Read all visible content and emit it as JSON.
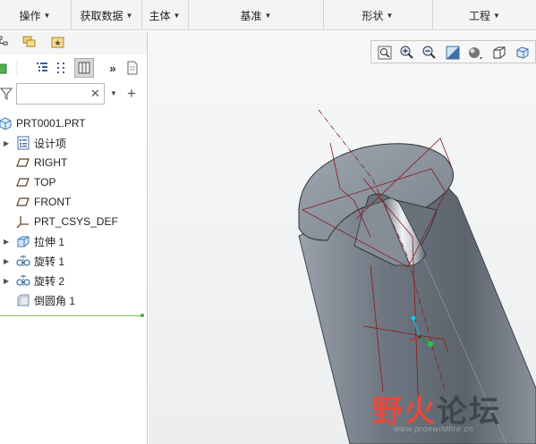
{
  "ribbon": {
    "groups": [
      "操作",
      "获取数据",
      "主体",
      "基准",
      "形状",
      "工程"
    ]
  },
  "model_tree": {
    "search_placeholder": "",
    "root": "PRT0001.PRT",
    "items": [
      {
        "label": "设计项",
        "expandable": true,
        "icon": "design-items-icon"
      },
      {
        "label": "RIGHT",
        "expandable": false,
        "icon": "datum-plane-icon"
      },
      {
        "label": "TOP",
        "expandable": false,
        "icon": "datum-plane-icon"
      },
      {
        "label": "FRONT",
        "expandable": false,
        "icon": "datum-plane-icon"
      },
      {
        "label": "PRT_CSYS_DEF",
        "expandable": false,
        "icon": "csys-icon"
      },
      {
        "label": "拉伸 1",
        "expandable": true,
        "icon": "extrude-icon"
      },
      {
        "label": "旋转 1",
        "expandable": true,
        "icon": "revolve-icon"
      },
      {
        "label": "旋转 2",
        "expandable": true,
        "icon": "revolve-icon"
      },
      {
        "label": "倒圆角 1",
        "expandable": false,
        "icon": "round-icon"
      }
    ]
  },
  "graphics_toolbar": {
    "buttons": [
      "refit-icon",
      "zoom-in-icon",
      "zoom-out-icon",
      "repaint-icon",
      "display-style-icon",
      "saved-views-icon",
      "view-orientation-icon"
    ]
  },
  "watermark": {
    "brand": "野火论坛",
    "url": "www.proewildfire.cn"
  },
  "colors": {
    "accent_green": "#7ac142",
    "model_body": "#7d8590",
    "datum_lines": "#8b1a1a",
    "watermark_red": "#e34a3c",
    "watermark_gray": "#404650"
  }
}
